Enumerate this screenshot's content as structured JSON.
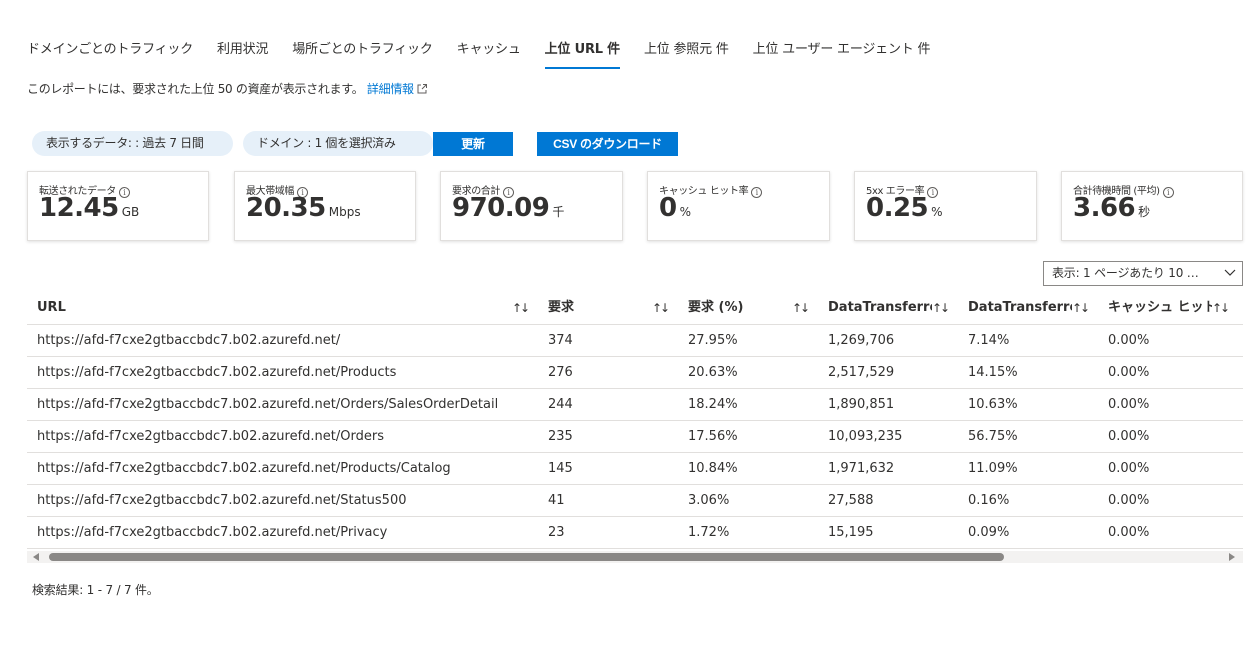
{
  "tabs": [
    {
      "label": "ドメインごとのトラフィック",
      "active": false
    },
    {
      "label": "利用状況",
      "active": false
    },
    {
      "label": "場所ごとのトラフィック",
      "active": false
    },
    {
      "label": "キャッシュ",
      "active": false
    },
    {
      "label": "上位 URL 件",
      "active": true
    },
    {
      "label": "上位 参照元 件",
      "active": false
    },
    {
      "label": "上位 ユーザー エージェント 件",
      "active": false
    }
  ],
  "description": {
    "text": "このレポートには、要求された上位 50 の資産が表示されます。",
    "link": "詳細情報"
  },
  "filters": {
    "time_range": "表示するデータ: : 過去 7 日間",
    "domain": "ドメイン : 1 個を選択済み",
    "refresh": "更新",
    "download": "CSV のダウンロード"
  },
  "cards": [
    {
      "label": "転送されたデータ",
      "value": "12.45",
      "unit": "GB"
    },
    {
      "label": "最大帯域幅",
      "value": "20.35",
      "unit": "Mbps"
    },
    {
      "label": "要求の合計",
      "value": "970.09",
      "unit": "千"
    },
    {
      "label": "キャッシュ ヒット率",
      "value": "0",
      "unit": "%"
    },
    {
      "label": "5xx エラー率",
      "value": "0.25",
      "unit": "%"
    },
    {
      "label": "合計待機時間 (平均)",
      "value": "3.66",
      "unit": "秒"
    }
  ],
  "page_size": "表示: 1 ページあたり 10 …",
  "table": {
    "columns": [
      "URL",
      "要求",
      "要求 (%)",
      "DataTransferre…",
      "DataTransferre…",
      "キャッシュ ヒット率 …"
    ],
    "rows": [
      [
        "https://afd-f7cxe2gtbaccbdc7.b02.azurefd.net/",
        "374",
        "27.95%",
        "1,269,706",
        "7.14%",
        "0.00%"
      ],
      [
        "https://afd-f7cxe2gtbaccbdc7.b02.azurefd.net/Products",
        "276",
        "20.63%",
        "2,517,529",
        "14.15%",
        "0.00%"
      ],
      [
        "https://afd-f7cxe2gtbaccbdc7.b02.azurefd.net/Orders/SalesOrderDetail",
        "244",
        "18.24%",
        "1,890,851",
        "10.63%",
        "0.00%"
      ],
      [
        "https://afd-f7cxe2gtbaccbdc7.b02.azurefd.net/Orders",
        "235",
        "17.56%",
        "10,093,235",
        "56.75%",
        "0.00%"
      ],
      [
        "https://afd-f7cxe2gtbaccbdc7.b02.azurefd.net/Products/Catalog",
        "145",
        "10.84%",
        "1,971,632",
        "11.09%",
        "0.00%"
      ],
      [
        "https://afd-f7cxe2gtbaccbdc7.b02.azurefd.net/Status500",
        "41",
        "3.06%",
        "27,588",
        "0.16%",
        "0.00%"
      ],
      [
        "https://afd-f7cxe2gtbaccbdc7.b02.azurefd.net/Privacy",
        "23",
        "1.72%",
        "15,195",
        "0.09%",
        "0.00%"
      ]
    ]
  },
  "footer": "検索結果: 1 - 7 / 7 件。",
  "colors": {
    "accent": "#0078d4",
    "pill": "#e6f0f9",
    "text": "#323130",
    "border": "#e1dfdd"
  }
}
